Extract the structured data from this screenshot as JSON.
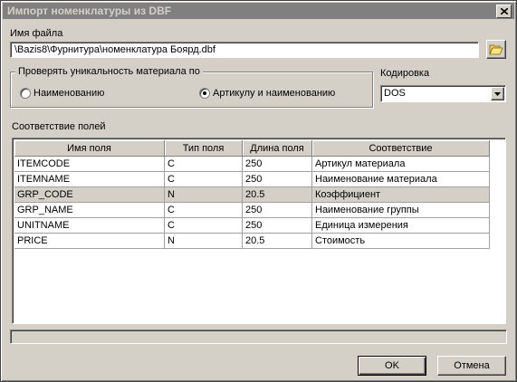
{
  "window": {
    "title": "Импорт номенклатуры из DBF"
  },
  "file": {
    "label": "Имя файла",
    "value": "\\Bazis8\\Фурнитура\\номенклатура Боярд.dbf"
  },
  "uniqueness": {
    "legend": "Проверять уникальность материала по",
    "options": [
      {
        "label": "Наименованию",
        "checked": false
      },
      {
        "label": "Артикулу и наименованию",
        "checked": true
      }
    ]
  },
  "encoding": {
    "label": "Кодировка",
    "value": "DOS"
  },
  "mapping": {
    "label": "Соответствие полей",
    "columns": [
      "Имя поля",
      "Тип поля",
      "Длина поля",
      "Соответствие"
    ],
    "rows": [
      [
        "ITEMCODE",
        "C",
        "250",
        "Артикул материала"
      ],
      [
        "ITEMNAME",
        "C",
        "250",
        "Наименование материала"
      ],
      [
        "GRP_CODE",
        "N",
        "20.5",
        "Коэффициент"
      ],
      [
        "GRP_NAME",
        "C",
        "250",
        "Наименование группы"
      ],
      [
        "UNITNAME",
        "C",
        "250",
        "Единица измерения"
      ],
      [
        "PRICE",
        "N",
        "20.5",
        "Стоимость"
      ]
    ],
    "selected_row": 2
  },
  "progress": {
    "value": 0
  },
  "buttons": {
    "ok": "OK",
    "cancel": "Отмена"
  }
}
